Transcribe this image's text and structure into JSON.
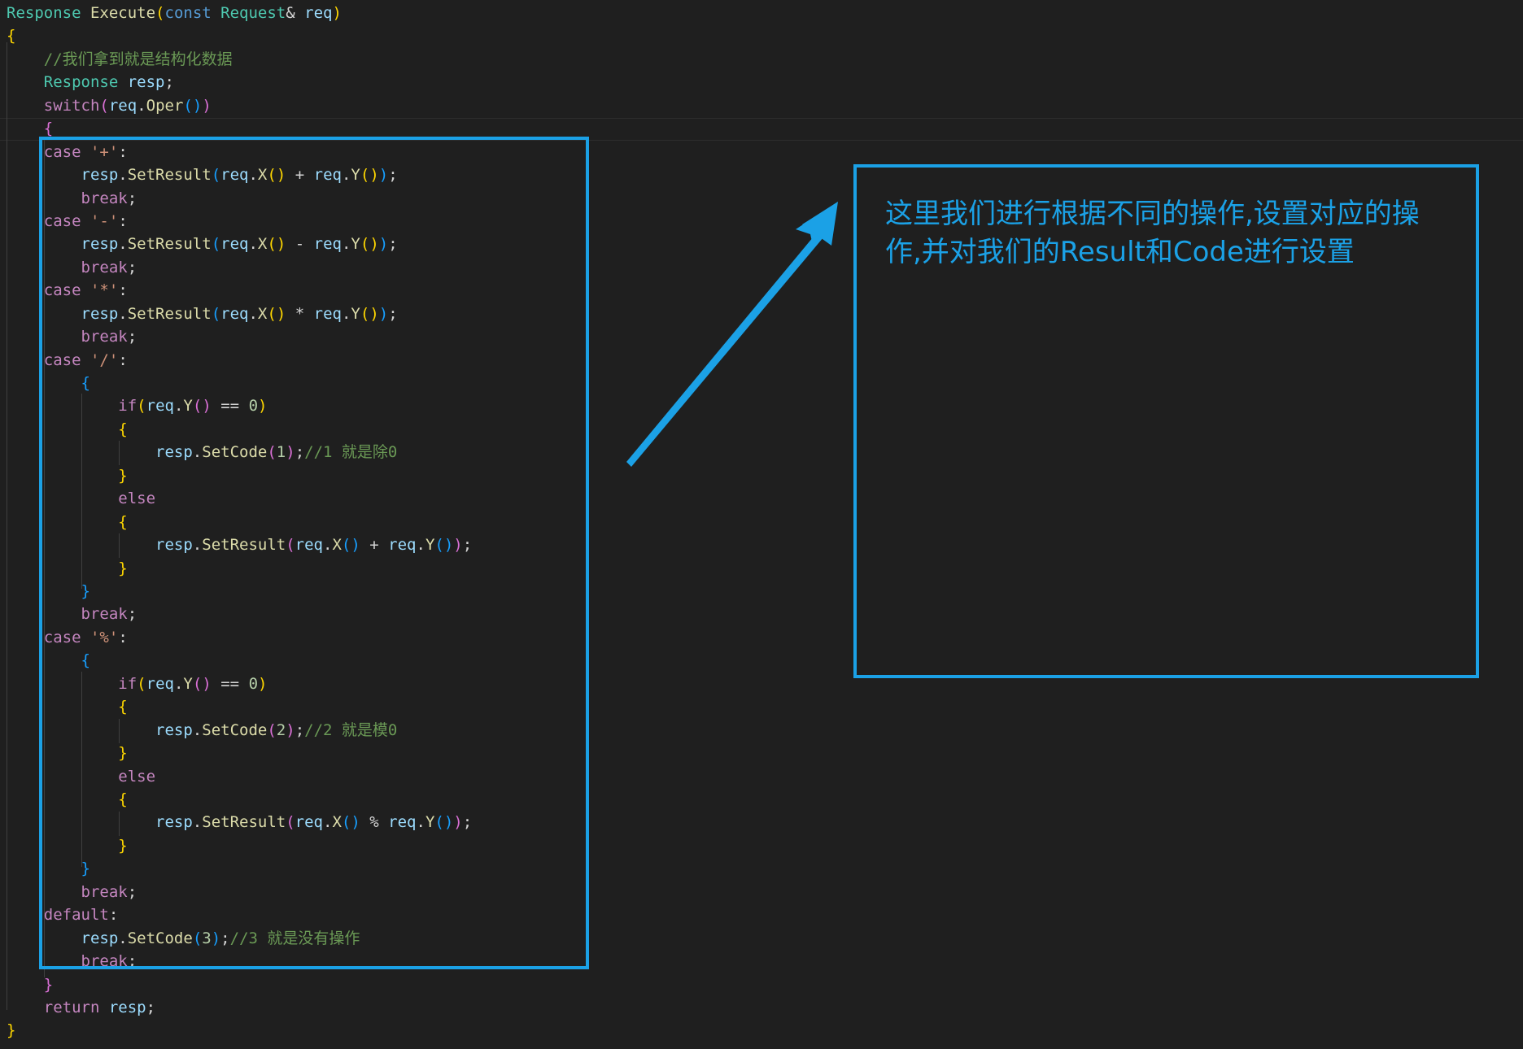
{
  "code_lines": [
    "Response Execute(const Request& req)",
    "{",
    "    //我们拿到就是结构化数据",
    "    Response resp;",
    "    switch(req.Oper())",
    "    {",
    "    case '+':",
    "        resp.SetResult(req.X() + req.Y());",
    "        break;",
    "    case '-':",
    "        resp.SetResult(req.X() - req.Y());",
    "        break;",
    "    case '*':",
    "        resp.SetResult(req.X() * req.Y());",
    "        break;",
    "    case '/':",
    "        {",
    "            if(req.Y() == 0)",
    "            {",
    "                resp.SetCode(1);//1 就是除0",
    "            }",
    "            else",
    "            {",
    "                resp.SetResult(req.X() + req.Y());",
    "            }",
    "        }",
    "        break;",
    "    case '%':",
    "        {",
    "            if(req.Y() == 0)",
    "            {",
    "                resp.SetCode(2);//2 就是模0",
    "            }",
    "            else",
    "            {",
    "                resp.SetResult(req.X() % req.Y());",
    "            }",
    "        }",
    "        break;",
    "    default:",
    "        resp.SetCode(3);//3 就是没有操作",
    "        break;",
    "    }",
    "    return resp;",
    "}"
  ],
  "annotation": {
    "text": "这里我们进行根据不同的操作,设置对应的操作,并对我们的Result和Code进行设置"
  },
  "colors": {
    "background": "#1f1f1f",
    "annotation": "#1ba1e6",
    "keyword": "#569cd6",
    "control": "#c586c0",
    "type": "#4ec9b0",
    "function": "#dcdcaa",
    "variable": "#9cdcfe",
    "number": "#b5cea8",
    "string": "#ce9178",
    "comment": "#6a9955"
  }
}
